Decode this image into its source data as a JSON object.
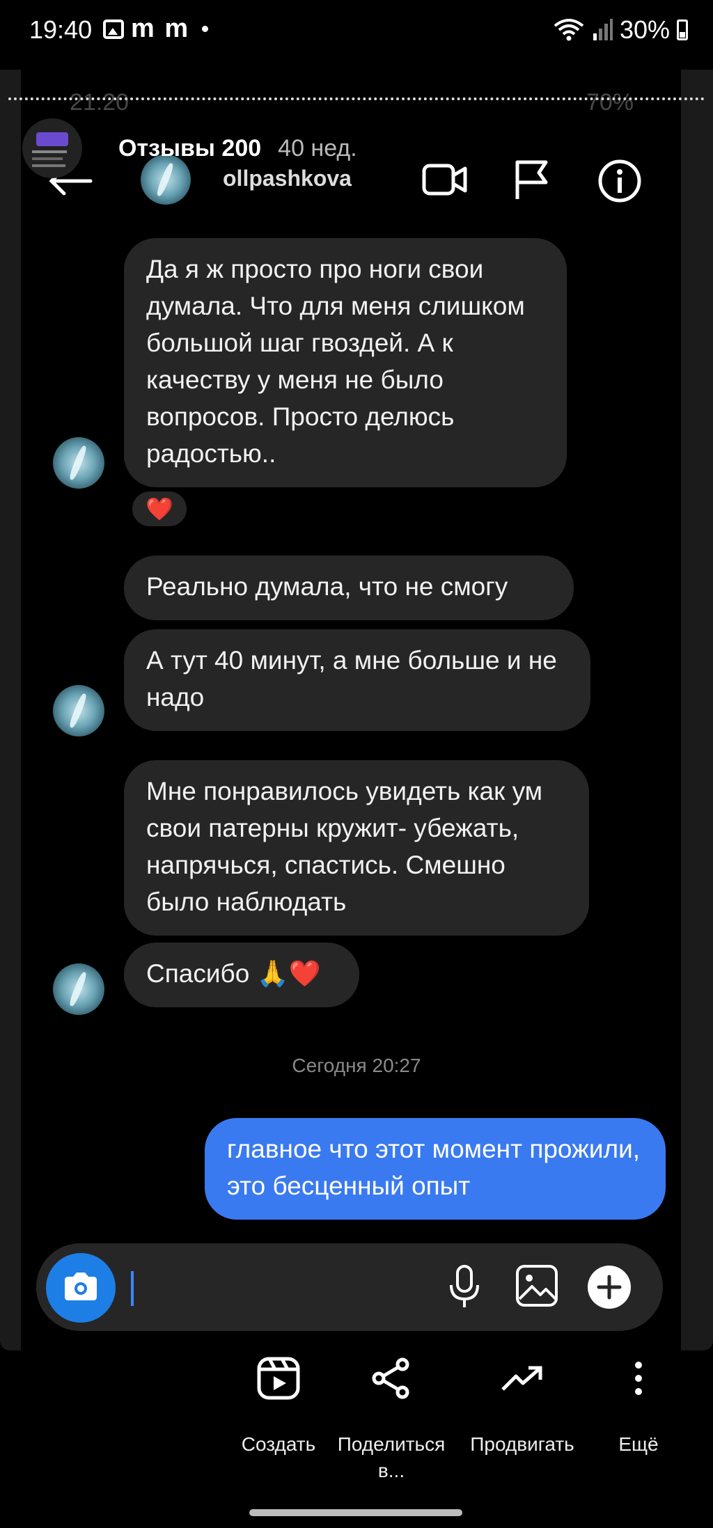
{
  "status_bar": {
    "time": "19:40",
    "notif_letters": "m m",
    "battery": "30%"
  },
  "inner_status": {
    "time": "21:20",
    "battery": "70%"
  },
  "overlay": {
    "title": "Отзывы 200",
    "time_ago": "40 нед."
  },
  "chat": {
    "username": "ollpashkova",
    "messages": [
      {
        "from": "them",
        "text": "Да я ж просто про ноги свои думала. Что для меня слишком большой шаг гвоздей. А к качеству у меня не было вопросов. Просто делюсь радостью..",
        "reaction": "❤️"
      },
      {
        "from": "them",
        "text": "Реально думала, что не смогу"
      },
      {
        "from": "them",
        "text": "А тут 40 минут, а мне больше и не надо"
      },
      {
        "from": "them",
        "text": "Мне понравилось увидеть как ум свои патерны кружит- убежать, напрячься, спастись. Смешно было наблюдать"
      },
      {
        "from": "them",
        "text": "Спасибо 🙏❤️"
      },
      {
        "from": "me",
        "text": "главное что этот момент прожили, это бесценный опыт"
      }
    ],
    "date_separator": "Сегодня 20:27"
  },
  "actions": [
    {
      "label": "Создать",
      "icon": "reels-create-icon"
    },
    {
      "label": "Поделиться в...",
      "icon": "share-icon"
    },
    {
      "label": "Продвигать",
      "icon": "trending-up-icon"
    },
    {
      "label": "Ещё",
      "icon": "more-vertical-icon"
    }
  ],
  "colors": {
    "bubble_them": "#262626",
    "bubble_me": "#3a7af0",
    "camera_button": "#1d7ee6",
    "heart": "#ff2d47"
  }
}
